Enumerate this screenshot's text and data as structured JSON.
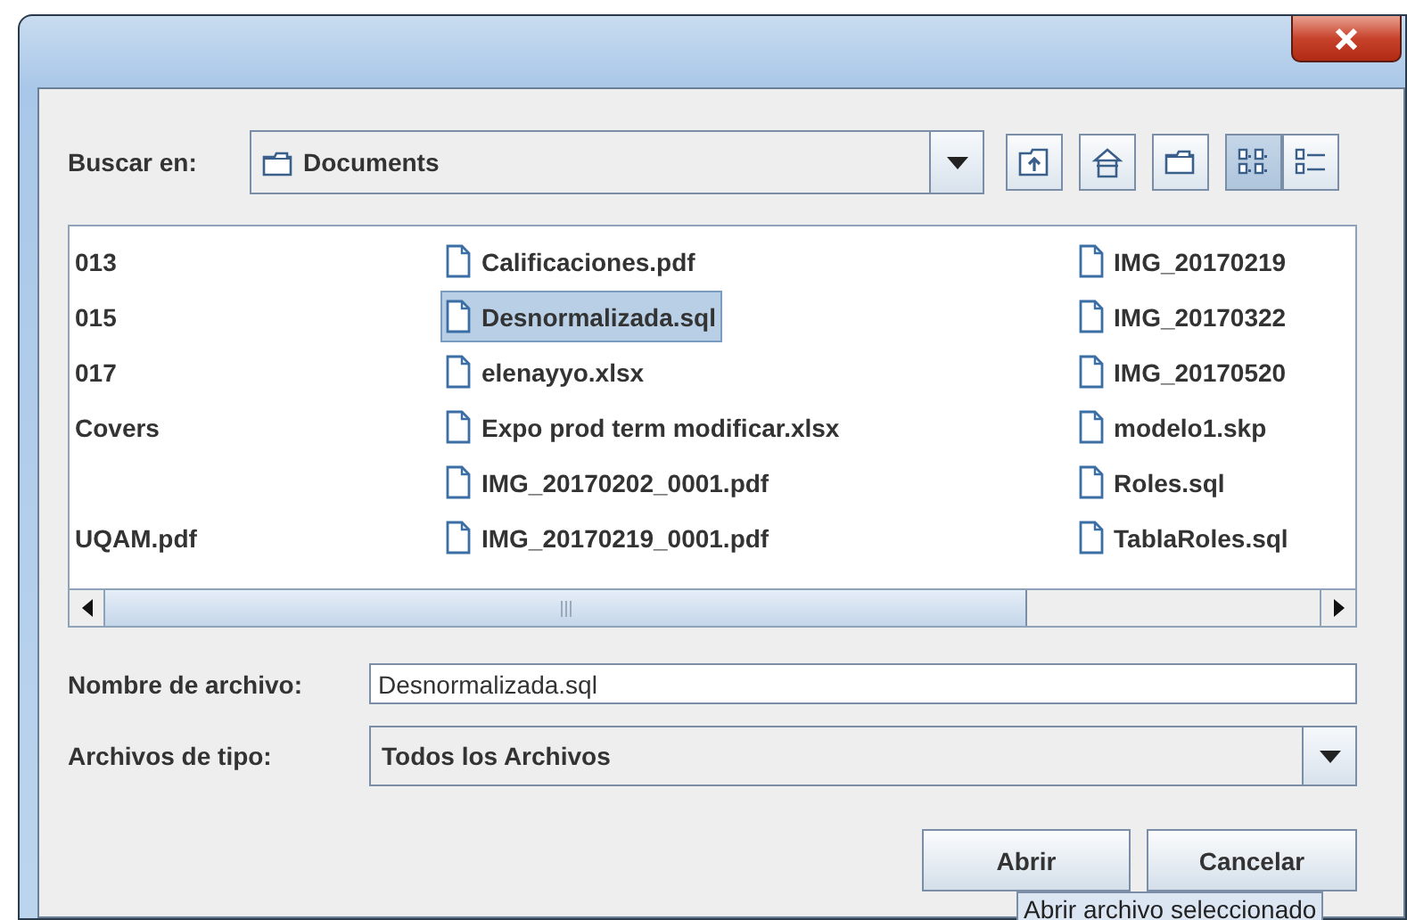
{
  "dialog": {
    "look_in": {
      "label": "Buscar en:",
      "value": "Documents"
    },
    "toolbar": [
      {
        "kind": "up",
        "selected": false
      },
      {
        "kind": "home",
        "selected": false
      },
      {
        "kind": "new-folder",
        "selected": false
      },
      {
        "kind": "list-view",
        "selected": true
      },
      {
        "kind": "details-view",
        "selected": false
      }
    ],
    "file_list": {
      "columns": [
        [
          {
            "kind": "clipped",
            "name": "013",
            "selected": false
          },
          {
            "kind": "clipped",
            "name": "015",
            "selected": false
          },
          {
            "kind": "clipped",
            "name": "017",
            "selected": false
          },
          {
            "kind": "clipped",
            "name": "Covers",
            "selected": false
          },
          {
            "kind": "blank"
          },
          {
            "kind": "clipped",
            "name": "UQAM.pdf",
            "selected": false
          }
        ],
        [
          {
            "kind": "file",
            "name": "Calificaciones.pdf",
            "selected": false
          },
          {
            "kind": "file",
            "name": "Desnormalizada.sql",
            "selected": true
          },
          {
            "kind": "file",
            "name": "elenayyo.xlsx",
            "selected": false
          },
          {
            "kind": "file",
            "name": "Expo prod term modificar.xlsx",
            "selected": false
          },
          {
            "kind": "file",
            "name": "IMG_20170202_0001.pdf",
            "selected": false
          },
          {
            "kind": "file",
            "name": "IMG_20170219_0001.pdf",
            "selected": false
          }
        ],
        [
          {
            "kind": "file",
            "name": "IMG_20170219",
            "selected": false
          },
          {
            "kind": "file",
            "name": "IMG_20170322",
            "selected": false
          },
          {
            "kind": "file",
            "name": "IMG_20170520",
            "selected": false
          },
          {
            "kind": "file",
            "name": "modelo1.skp",
            "selected": false
          },
          {
            "kind": "file",
            "name": "Roles.sql",
            "selected": false
          },
          {
            "kind": "file",
            "name": "TablaRoles.sql",
            "selected": false
          }
        ]
      ]
    },
    "file_name": {
      "label": "Nombre de archivo:",
      "value": "Desnormalizada.sql"
    },
    "file_type": {
      "label": "Archivos de tipo:",
      "value": "Todos los Archivos"
    },
    "buttons": [
      "Abrir",
      "Cancelar"
    ],
    "tooltip": "Abrir archivo seleccionado"
  }
}
